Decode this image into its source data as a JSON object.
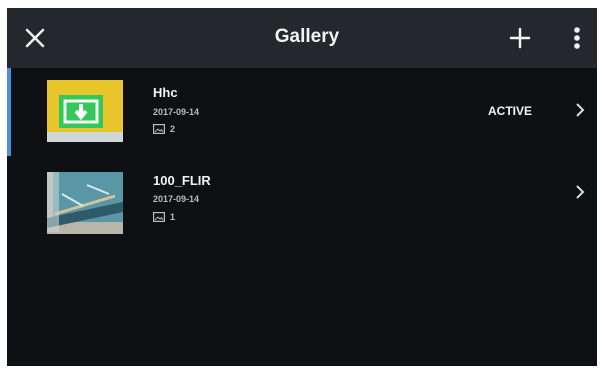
{
  "header": {
    "title": "Gallery",
    "icons": {
      "close": "close-icon",
      "add": "plus-icon",
      "more": "more-vertical-icon"
    }
  },
  "gallery": {
    "items": [
      {
        "name": "Hhc",
        "date": "2017-09-14",
        "image_count": "2",
        "status": "ACTIVE",
        "thumbnail": "yellow-download-thumbnail"
      },
      {
        "name": "100_FLIR",
        "date": "2017-09-14",
        "image_count": "1",
        "status": "",
        "thumbnail": "thermal-pool-thumbnail"
      }
    ]
  },
  "colors": {
    "background": "#0e1013",
    "header": "#24272b",
    "text": "#f2f2f2",
    "secondary_text": "#b9bcc0",
    "accent": "#4a90e2",
    "thumb_yellow": "#e8c52a",
    "thumb_green": "#34c759"
  }
}
